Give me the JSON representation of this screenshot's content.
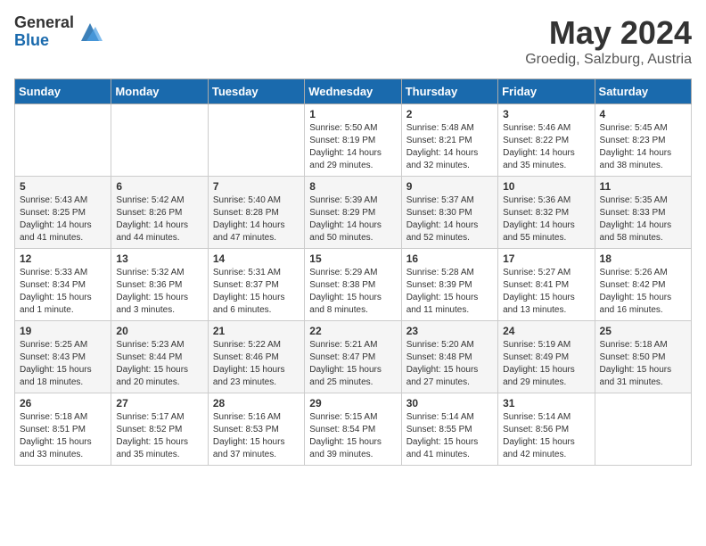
{
  "header": {
    "logo_general": "General",
    "logo_blue": "Blue",
    "month_title": "May 2024",
    "location": "Groedig, Salzburg, Austria"
  },
  "days_of_week": [
    "Sunday",
    "Monday",
    "Tuesday",
    "Wednesday",
    "Thursday",
    "Friday",
    "Saturday"
  ],
  "weeks": [
    [
      {
        "day": "",
        "info": ""
      },
      {
        "day": "",
        "info": ""
      },
      {
        "day": "",
        "info": ""
      },
      {
        "day": "1",
        "info": "Sunrise: 5:50 AM\nSunset: 8:19 PM\nDaylight: 14 hours\nand 29 minutes."
      },
      {
        "day": "2",
        "info": "Sunrise: 5:48 AM\nSunset: 8:21 PM\nDaylight: 14 hours\nand 32 minutes."
      },
      {
        "day": "3",
        "info": "Sunrise: 5:46 AM\nSunset: 8:22 PM\nDaylight: 14 hours\nand 35 minutes."
      },
      {
        "day": "4",
        "info": "Sunrise: 5:45 AM\nSunset: 8:23 PM\nDaylight: 14 hours\nand 38 minutes."
      }
    ],
    [
      {
        "day": "5",
        "info": "Sunrise: 5:43 AM\nSunset: 8:25 PM\nDaylight: 14 hours\nand 41 minutes."
      },
      {
        "day": "6",
        "info": "Sunrise: 5:42 AM\nSunset: 8:26 PM\nDaylight: 14 hours\nand 44 minutes."
      },
      {
        "day": "7",
        "info": "Sunrise: 5:40 AM\nSunset: 8:28 PM\nDaylight: 14 hours\nand 47 minutes."
      },
      {
        "day": "8",
        "info": "Sunrise: 5:39 AM\nSunset: 8:29 PM\nDaylight: 14 hours\nand 50 minutes."
      },
      {
        "day": "9",
        "info": "Sunrise: 5:37 AM\nSunset: 8:30 PM\nDaylight: 14 hours\nand 52 minutes."
      },
      {
        "day": "10",
        "info": "Sunrise: 5:36 AM\nSunset: 8:32 PM\nDaylight: 14 hours\nand 55 minutes."
      },
      {
        "day": "11",
        "info": "Sunrise: 5:35 AM\nSunset: 8:33 PM\nDaylight: 14 hours\nand 58 minutes."
      }
    ],
    [
      {
        "day": "12",
        "info": "Sunrise: 5:33 AM\nSunset: 8:34 PM\nDaylight: 15 hours\nand 1 minute."
      },
      {
        "day": "13",
        "info": "Sunrise: 5:32 AM\nSunset: 8:36 PM\nDaylight: 15 hours\nand 3 minutes."
      },
      {
        "day": "14",
        "info": "Sunrise: 5:31 AM\nSunset: 8:37 PM\nDaylight: 15 hours\nand 6 minutes."
      },
      {
        "day": "15",
        "info": "Sunrise: 5:29 AM\nSunset: 8:38 PM\nDaylight: 15 hours\nand 8 minutes."
      },
      {
        "day": "16",
        "info": "Sunrise: 5:28 AM\nSunset: 8:39 PM\nDaylight: 15 hours\nand 11 minutes."
      },
      {
        "day": "17",
        "info": "Sunrise: 5:27 AM\nSunset: 8:41 PM\nDaylight: 15 hours\nand 13 minutes."
      },
      {
        "day": "18",
        "info": "Sunrise: 5:26 AM\nSunset: 8:42 PM\nDaylight: 15 hours\nand 16 minutes."
      }
    ],
    [
      {
        "day": "19",
        "info": "Sunrise: 5:25 AM\nSunset: 8:43 PM\nDaylight: 15 hours\nand 18 minutes."
      },
      {
        "day": "20",
        "info": "Sunrise: 5:23 AM\nSunset: 8:44 PM\nDaylight: 15 hours\nand 20 minutes."
      },
      {
        "day": "21",
        "info": "Sunrise: 5:22 AM\nSunset: 8:46 PM\nDaylight: 15 hours\nand 23 minutes."
      },
      {
        "day": "22",
        "info": "Sunrise: 5:21 AM\nSunset: 8:47 PM\nDaylight: 15 hours\nand 25 minutes."
      },
      {
        "day": "23",
        "info": "Sunrise: 5:20 AM\nSunset: 8:48 PM\nDaylight: 15 hours\nand 27 minutes."
      },
      {
        "day": "24",
        "info": "Sunrise: 5:19 AM\nSunset: 8:49 PM\nDaylight: 15 hours\nand 29 minutes."
      },
      {
        "day": "25",
        "info": "Sunrise: 5:18 AM\nSunset: 8:50 PM\nDaylight: 15 hours\nand 31 minutes."
      }
    ],
    [
      {
        "day": "26",
        "info": "Sunrise: 5:18 AM\nSunset: 8:51 PM\nDaylight: 15 hours\nand 33 minutes."
      },
      {
        "day": "27",
        "info": "Sunrise: 5:17 AM\nSunset: 8:52 PM\nDaylight: 15 hours\nand 35 minutes."
      },
      {
        "day": "28",
        "info": "Sunrise: 5:16 AM\nSunset: 8:53 PM\nDaylight: 15 hours\nand 37 minutes."
      },
      {
        "day": "29",
        "info": "Sunrise: 5:15 AM\nSunset: 8:54 PM\nDaylight: 15 hours\nand 39 minutes."
      },
      {
        "day": "30",
        "info": "Sunrise: 5:14 AM\nSunset: 8:55 PM\nDaylight: 15 hours\nand 41 minutes."
      },
      {
        "day": "31",
        "info": "Sunrise: 5:14 AM\nSunset: 8:56 PM\nDaylight: 15 hours\nand 42 minutes."
      },
      {
        "day": "",
        "info": ""
      }
    ]
  ]
}
